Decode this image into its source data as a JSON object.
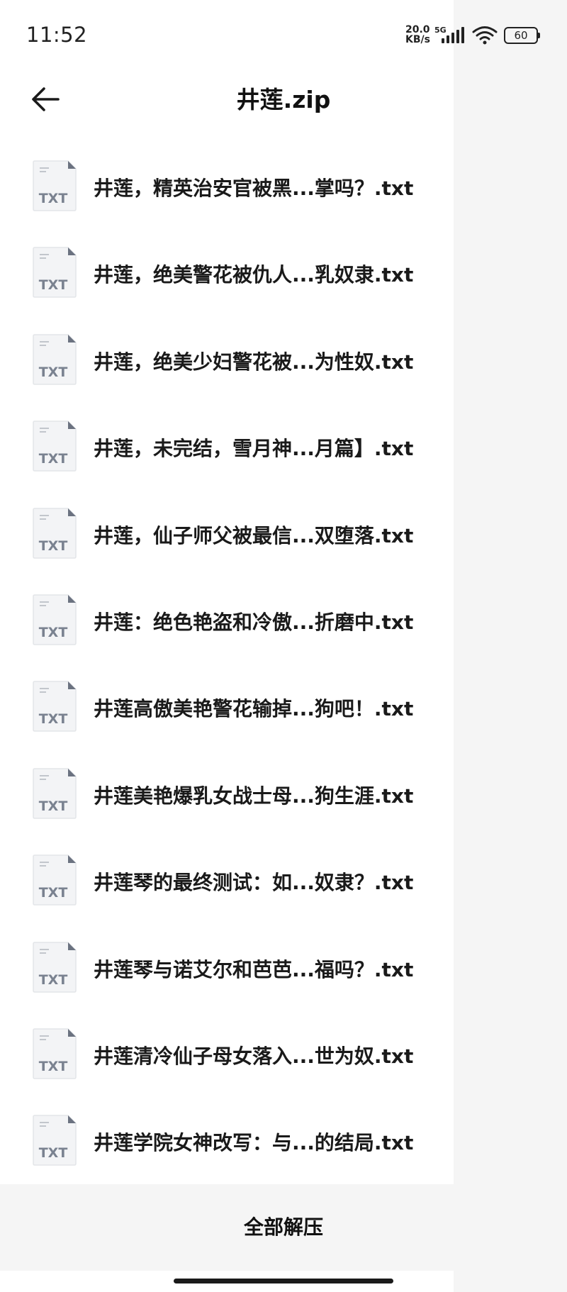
{
  "status_bar": {
    "time": "11:52",
    "net_speed_value": "20.0",
    "net_speed_unit": "KB/s",
    "network_type": "5G",
    "battery_level": "60"
  },
  "header": {
    "title": "井莲.zip",
    "back_icon": "arrow-left-icon"
  },
  "files": [
    {
      "icon": "txt-file-icon",
      "type_label": "TXT",
      "name": "井莲，精英治安官被黑...掌吗？.txt"
    },
    {
      "icon": "txt-file-icon",
      "type_label": "TXT",
      "name": "井莲，绝美警花被仇人...乳奴隶.txt"
    },
    {
      "icon": "txt-file-icon",
      "type_label": "TXT",
      "name": "井莲，绝美少妇警花被...为性奴.txt"
    },
    {
      "icon": "txt-file-icon",
      "type_label": "TXT",
      "name": "井莲，未完结，雪月神...月篇】.txt"
    },
    {
      "icon": "txt-file-icon",
      "type_label": "TXT",
      "name": "井莲，仙子师父被最信...双堕落.txt"
    },
    {
      "icon": "txt-file-icon",
      "type_label": "TXT",
      "name": "井莲：绝色艳盗和冷傲...折磨中.txt"
    },
    {
      "icon": "txt-file-icon",
      "type_label": "TXT",
      "name": "井莲高傲美艳警花输掉...狗吧！.txt"
    },
    {
      "icon": "txt-file-icon",
      "type_label": "TXT",
      "name": "井莲美艳爆乳女战士母...狗生涯.txt"
    },
    {
      "icon": "txt-file-icon",
      "type_label": "TXT",
      "name": "井莲琴的最终测试：如...奴隶？.txt"
    },
    {
      "icon": "txt-file-icon",
      "type_label": "TXT",
      "name": "井莲琴与诺艾尔和芭芭...福吗？.txt"
    },
    {
      "icon": "txt-file-icon",
      "type_label": "TXT",
      "name": "井莲清冷仙子母女落入...世为奴.txt"
    },
    {
      "icon": "txt-file-icon",
      "type_label": "TXT",
      "name": "井莲学院女神改写：与...的结局.txt"
    }
  ],
  "footer": {
    "extract_all_label": "全部解压"
  },
  "colors": {
    "panel_bg": "#ffffff",
    "outer_bg": "#f5f5f5",
    "text": "#1a1a1a",
    "file_icon_label": "#7a8290",
    "file_icon_corner": "#6b7280"
  }
}
